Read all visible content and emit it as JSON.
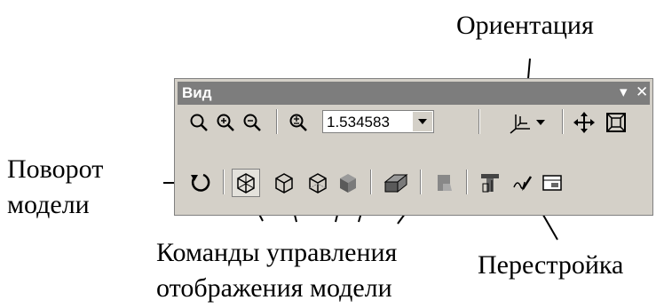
{
  "toolbar": {
    "title": "Вид",
    "zoom_value": "1.534583"
  },
  "callouts": {
    "orientation": "Ориентация",
    "rotate_line1": "Поворот",
    "rotate_line2": "модели",
    "display_line1": "Команды управления",
    "display_line2": "отображения модели",
    "rebuild": "Перестройка"
  },
  "icons": {
    "row1": [
      "zoom-window-icon",
      "zoom-in-icon",
      "zoom-out-icon",
      "zoom-scale-icon",
      "orientation-icon",
      "pan-icon",
      "fit-all-icon"
    ],
    "row2": [
      "rotate-icon",
      "wireframe-icon",
      "hidden-lines-icon",
      "hidden-lines-thin-icon",
      "shaded-icon",
      "shaded-edges-icon",
      "perspective-icon",
      "rebuild-icon",
      "sketch-icon",
      "section-icon"
    ]
  },
  "colors": {
    "panel": "#d4d0c8",
    "titlebar": "#7d7d7d",
    "shading": "#646464"
  }
}
